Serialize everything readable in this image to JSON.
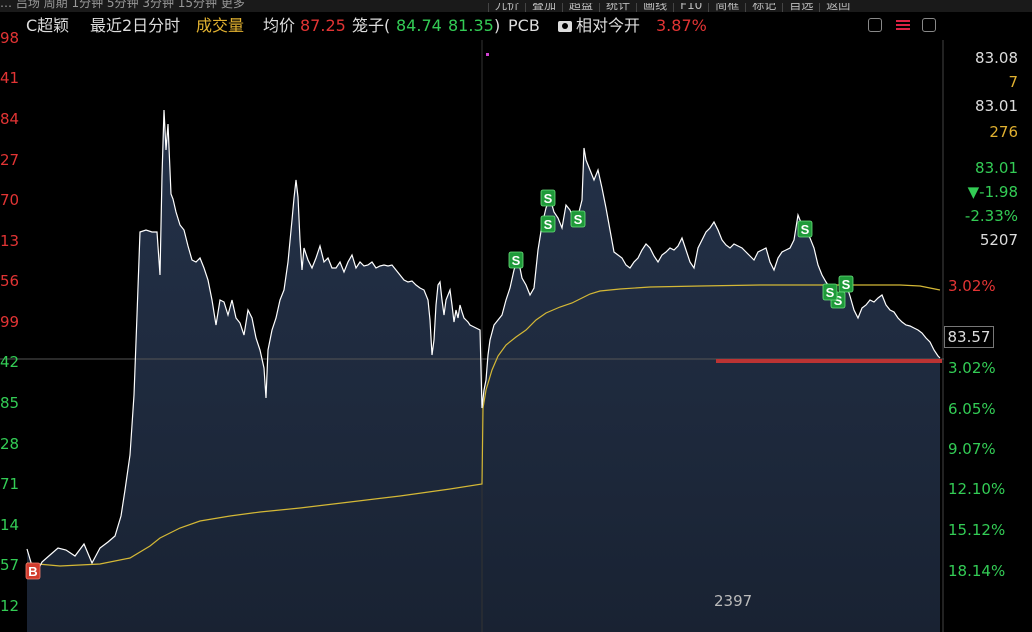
{
  "topbar": {
    "left_fragment": "… 吕场  周期  1分钟  5分钟  3分钟  15分钟  更多",
    "right_tabs": [
      "九价",
      "叠加",
      "超盘",
      "统计",
      "画线",
      "F10",
      "简框",
      "标记",
      "自选",
      "返回"
    ]
  },
  "header": {
    "symbol": "C超颖",
    "period": "最近2日分时",
    "volume_label": "成交量",
    "avg_label": "均价",
    "avg_value": "87.25",
    "cage_label": "笼子(",
    "cage_low": "84.74",
    "cage_high": "81.35",
    "cage_close": ")",
    "sector": "PCB",
    "relative_label": "相对今开",
    "relative_value": "3.87%"
  },
  "right_panel": {
    "v1": "83.08",
    "v2": "7",
    "v3": "83.01",
    "v4": "276",
    "v5": "83.01",
    "v6": "▼-1.98",
    "v7": "-2.33%",
    "v8": "5207",
    "last_price": "83.57",
    "volume_total": "2397"
  },
  "chart_data": {
    "type": "line",
    "title": "",
    "left_tick_labels": [
      "98",
      "41",
      "84",
      "27",
      "70",
      "13",
      "56",
      "99",
      "42",
      "85",
      "28",
      "71",
      "14",
      "57",
      "12"
    ],
    "right_pct_labels": [
      "3.02%",
      "",
      "3.02%",
      "6.05%",
      "9.07%",
      "12.10%",
      "15.12%",
      "18.14%"
    ],
    "markers": {
      "S": 9,
      "B": 1
    },
    "series": [
      {
        "name": "",
        "color": "#ffffff",
        "values": [
          [
            27,
            549
          ],
          [
            35,
            576
          ],
          [
            42,
            562
          ],
          [
            50,
            555
          ],
          [
            58,
            548
          ],
          [
            66,
            550
          ],
          [
            75,
            556
          ],
          [
            84,
            544
          ],
          [
            92,
            563
          ],
          [
            100,
            548
          ],
          [
            108,
            542
          ],
          [
            115,
            536
          ],
          [
            121,
            516
          ],
          [
            125,
            490
          ],
          [
            130,
            455
          ],
          [
            134,
            395
          ],
          [
            137,
            315
          ],
          [
            140,
            232
          ],
          [
            146,
            230
          ],
          [
            152,
            232
          ],
          [
            157,
            232
          ],
          [
            160,
            275
          ],
          [
            162,
            176
          ],
          [
            164,
            110
          ],
          [
            166,
            150
          ],
          [
            168,
            124
          ],
          [
            171,
            194
          ],
          [
            173,
            199
          ],
          [
            176,
            212
          ],
          [
            180,
            225
          ],
          [
            184,
            230
          ],
          [
            188,
            246
          ],
          [
            192,
            260
          ],
          [
            196,
            262
          ],
          [
            200,
            258
          ],
          [
            204,
            268
          ],
          [
            208,
            280
          ],
          [
            212,
            300
          ],
          [
            216,
            325
          ],
          [
            220,
            300
          ],
          [
            224,
            302
          ],
          [
            228,
            315
          ],
          [
            232,
            300
          ],
          [
            236,
            318
          ],
          [
            240,
            323
          ],
          [
            244,
            335
          ],
          [
            248,
            310
          ],
          [
            252,
            318
          ],
          [
            256,
            338
          ],
          [
            260,
            350
          ],
          [
            264,
            368
          ],
          [
            266,
            398
          ],
          [
            268,
            350
          ],
          [
            272,
            330
          ],
          [
            276,
            318
          ],
          [
            280,
            300
          ],
          [
            284,
            290
          ],
          [
            288,
            262
          ],
          [
            292,
            220
          ],
          [
            294,
            198
          ],
          [
            296,
            180
          ],
          [
            298,
            197
          ],
          [
            300,
            240
          ],
          [
            302,
            270
          ],
          [
            304,
            248
          ],
          [
            308,
            260
          ],
          [
            312,
            268
          ],
          [
            316,
            258
          ],
          [
            320,
            246
          ],
          [
            324,
            262
          ],
          [
            328,
            258
          ],
          [
            332,
            268
          ],
          [
            336,
            268
          ],
          [
            340,
            262
          ],
          [
            344,
            272
          ],
          [
            348,
            262
          ],
          [
            352,
            255
          ],
          [
            356,
            268
          ],
          [
            360,
            262
          ],
          [
            364,
            266
          ],
          [
            368,
            265
          ],
          [
            372,
            262
          ],
          [
            376,
            268
          ],
          [
            380,
            266
          ],
          [
            384,
            265
          ],
          [
            388,
            266
          ],
          [
            392,
            265
          ],
          [
            396,
            270
          ],
          [
            400,
            275
          ],
          [
            404,
            280
          ],
          [
            408,
            282
          ],
          [
            412,
            281
          ],
          [
            416,
            285
          ],
          [
            420,
            288
          ],
          [
            424,
            290
          ],
          [
            428,
            300
          ],
          [
            430,
            320
          ],
          [
            432,
            355
          ],
          [
            434,
            340
          ],
          [
            436,
            305
          ],
          [
            438,
            285
          ],
          [
            440,
            282
          ],
          [
            442,
            300
          ],
          [
            444,
            315
          ],
          [
            446,
            300
          ],
          [
            448,
            295
          ],
          [
            450,
            290
          ],
          [
            452,
            305
          ],
          [
            454,
            322
          ],
          [
            456,
            310
          ],
          [
            458,
            318
          ],
          [
            460,
            305
          ],
          [
            462,
            312
          ],
          [
            464,
            318
          ],
          [
            466,
            320
          ],
          [
            468,
            322
          ],
          [
            470,
            325
          ],
          [
            472,
            326
          ],
          [
            474,
            327
          ],
          [
            476,
            328
          ],
          [
            478,
            329
          ],
          [
            480,
            330
          ],
          [
            482,
            408
          ],
          [
            484,
            390
          ],
          [
            486,
            380
          ],
          [
            488,
            355
          ],
          [
            490,
            340
          ],
          [
            494,
            325
          ],
          [
            498,
            320
          ],
          [
            502,
            315
          ],
          [
            506,
            300
          ],
          [
            510,
            288
          ],
          [
            514,
            270
          ],
          [
            518,
            258
          ],
          [
            522,
            278
          ],
          [
            526,
            285
          ],
          [
            530,
            295
          ],
          [
            534,
            288
          ],
          [
            538,
            250
          ],
          [
            542,
            225
          ],
          [
            546,
            208
          ],
          [
            550,
            198
          ],
          [
            554,
            212
          ],
          [
            558,
            218
          ],
          [
            562,
            228
          ],
          [
            566,
            205
          ],
          [
            570,
            210
          ],
          [
            574,
            220
          ],
          [
            578,
            216
          ],
          [
            582,
            200
          ],
          [
            584,
            148
          ],
          [
            586,
            160
          ],
          [
            590,
            170
          ],
          [
            594,
            180
          ],
          [
            598,
            170
          ],
          [
            602,
            188
          ],
          [
            606,
            208
          ],
          [
            610,
            230
          ],
          [
            614,
            252
          ],
          [
            618,
            255
          ],
          [
            622,
            258
          ],
          [
            626,
            265
          ],
          [
            630,
            268
          ],
          [
            634,
            262
          ],
          [
            638,
            258
          ],
          [
            642,
            250
          ],
          [
            646,
            244
          ],
          [
            650,
            248
          ],
          [
            654,
            256
          ],
          [
            658,
            262
          ],
          [
            662,
            255
          ],
          [
            666,
            252
          ],
          [
            670,
            248
          ],
          [
            674,
            250
          ],
          [
            678,
            246
          ],
          [
            682,
            238
          ],
          [
            686,
            250
          ],
          [
            690,
            262
          ],
          [
            694,
            268
          ],
          [
            698,
            248
          ],
          [
            702,
            240
          ],
          [
            706,
            232
          ],
          [
            710,
            228
          ],
          [
            714,
            222
          ],
          [
            718,
            230
          ],
          [
            722,
            240
          ],
          [
            726,
            245
          ],
          [
            730,
            248
          ],
          [
            734,
            244
          ],
          [
            738,
            246
          ],
          [
            742,
            248
          ],
          [
            746,
            252
          ],
          [
            750,
            256
          ],
          [
            754,
            260
          ],
          [
            758,
            252
          ],
          [
            762,
            250
          ],
          [
            766,
            248
          ],
          [
            770,
            262
          ],
          [
            774,
            270
          ],
          [
            778,
            258
          ],
          [
            782,
            252
          ],
          [
            786,
            250
          ],
          [
            790,
            248
          ],
          [
            794,
            240
          ],
          [
            798,
            215
          ],
          [
            802,
            225
          ],
          [
            806,
            232
          ],
          [
            810,
            238
          ],
          [
            814,
            248
          ],
          [
            818,
            265
          ],
          [
            822,
            275
          ],
          [
            826,
            282
          ],
          [
            830,
            288
          ],
          [
            834,
            295
          ],
          [
            838,
            300
          ],
          [
            842,
            285
          ],
          [
            846,
            284
          ],
          [
            850,
            296
          ],
          [
            854,
            310
          ],
          [
            858,
            318
          ],
          [
            862,
            308
          ],
          [
            866,
            305
          ],
          [
            870,
            300
          ],
          [
            874,
            302
          ],
          [
            878,
            298
          ],
          [
            882,
            295
          ],
          [
            886,
            305
          ],
          [
            890,
            310
          ],
          [
            894,
            312
          ],
          [
            898,
            318
          ],
          [
            902,
            322
          ],
          [
            906,
            325
          ],
          [
            910,
            326
          ],
          [
            914,
            328
          ],
          [
            918,
            330
          ],
          [
            922,
            333
          ],
          [
            926,
            338
          ],
          [
            930,
            342
          ],
          [
            934,
            350
          ],
          [
            938,
            356
          ],
          [
            940,
            358
          ]
        ]
      },
      {
        "name": "",
        "color": "#d4b836",
        "values": [
          [
            27,
            563
          ],
          [
            60,
            566
          ],
          [
            100,
            564
          ],
          [
            130,
            558
          ],
          [
            150,
            546
          ],
          [
            160,
            538
          ],
          [
            180,
            528
          ],
          [
            200,
            521
          ],
          [
            230,
            516
          ],
          [
            260,
            512
          ],
          [
            300,
            508
          ],
          [
            350,
            502
          ],
          [
            400,
            496
          ],
          [
            450,
            489
          ],
          [
            482,
            484
          ],
          [
            483,
            408
          ],
          [
            486,
            390
          ],
          [
            492,
            370
          ],
          [
            498,
            356
          ],
          [
            506,
            345
          ],
          [
            516,
            337
          ],
          [
            526,
            330
          ],
          [
            536,
            320
          ],
          [
            546,
            313
          ],
          [
            560,
            307
          ],
          [
            572,
            303
          ],
          [
            582,
            298
          ],
          [
            590,
            294
          ],
          [
            600,
            291
          ],
          [
            620,
            289
          ],
          [
            650,
            287
          ],
          [
            700,
            286
          ],
          [
            760,
            285
          ],
          [
            800,
            285
          ],
          [
            850,
            285
          ],
          [
            900,
            285
          ],
          [
            920,
            286
          ],
          [
            940,
            290
          ]
        ]
      }
    ]
  }
}
